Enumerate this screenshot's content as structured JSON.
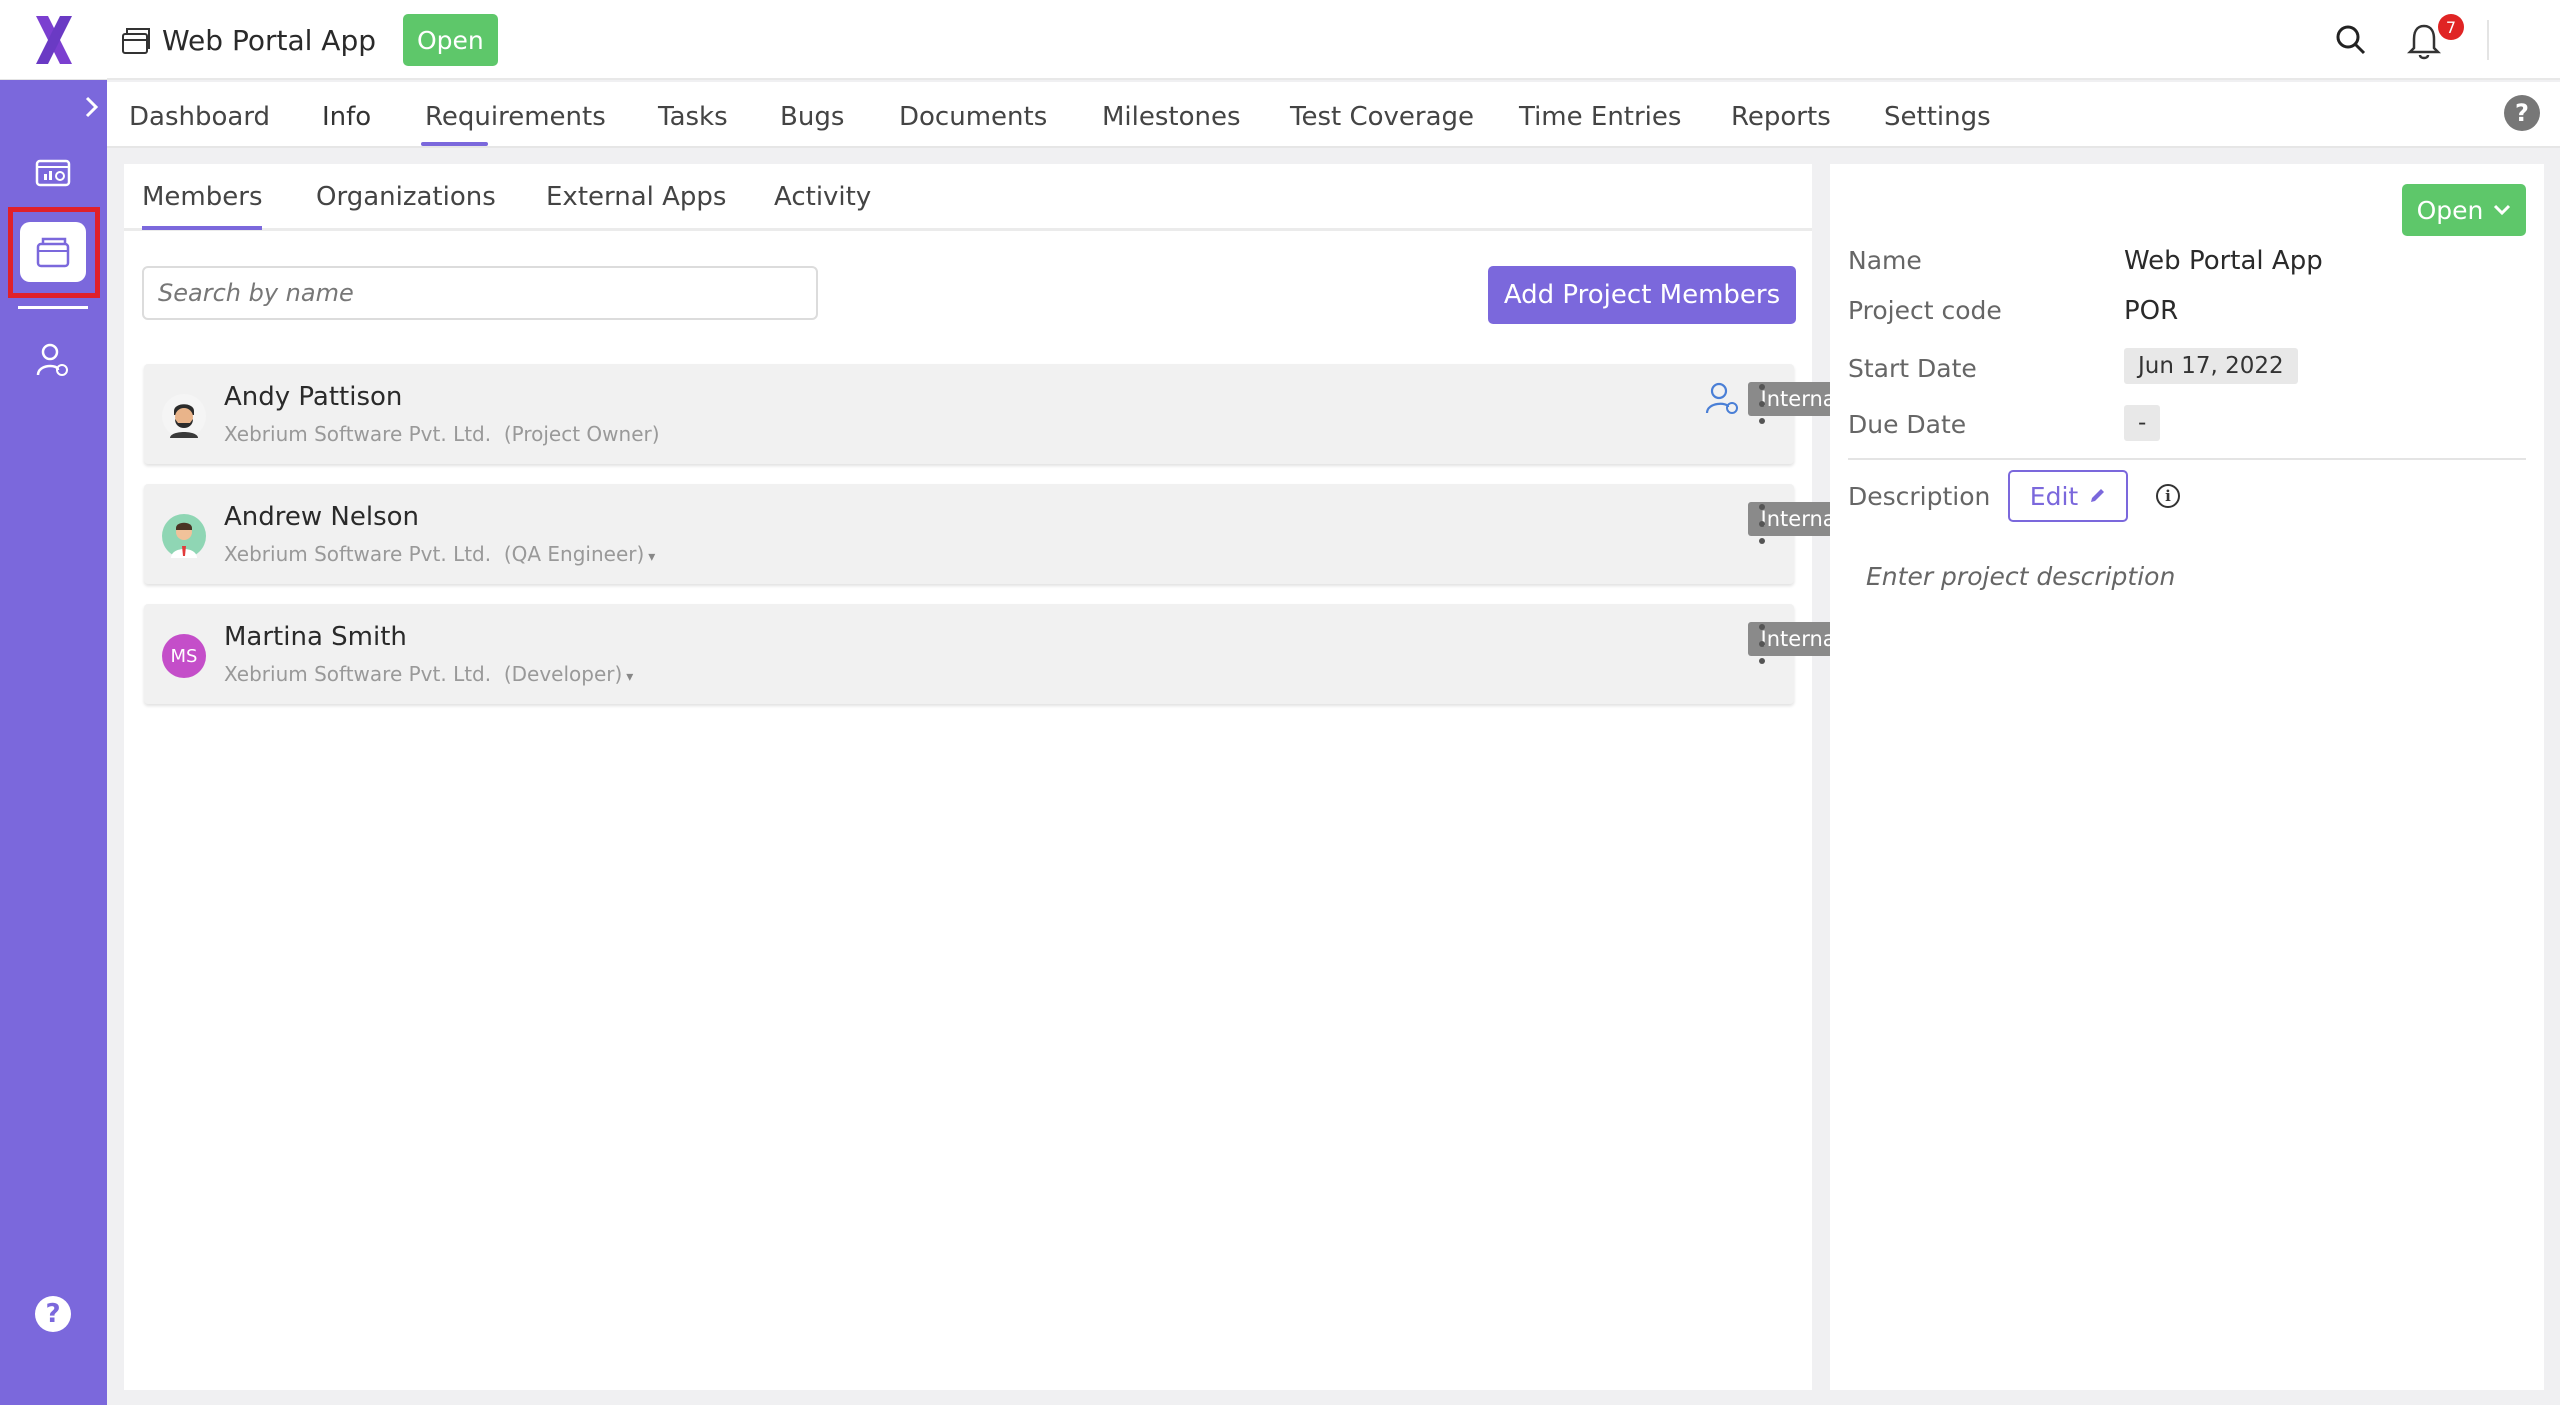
{
  "header": {
    "project_title": "Web Portal App",
    "status": "Open",
    "notification_count": "7"
  },
  "main_tabs": [
    {
      "label": "Dashboard"
    },
    {
      "label": "Info"
    },
    {
      "label": "Requirements"
    },
    {
      "label": "Tasks"
    },
    {
      "label": "Bugs"
    },
    {
      "label": "Documents"
    },
    {
      "label": "Milestones"
    },
    {
      "label": "Test Coverage"
    },
    {
      "label": "Time Entries"
    },
    {
      "label": "Reports"
    },
    {
      "label": "Settings"
    }
  ],
  "active_main_tab": "Info",
  "sub_tabs": [
    {
      "label": "Members"
    },
    {
      "label": "Organizations"
    },
    {
      "label": "External Apps"
    },
    {
      "label": "Activity"
    }
  ],
  "active_sub_tab": "Members",
  "members_panel": {
    "search_placeholder": "Search by name",
    "add_button": "Add Project Members",
    "members": [
      {
        "name": "Andy Pattison",
        "org": "Xebrium Software Pvt. Ltd.",
        "role": "(Project Owner)",
        "badge": "Internal",
        "avatar": "bearded-man-avatar"
      },
      {
        "name": "Andrew Nelson",
        "org": "Xebrium Software Pvt. Ltd.",
        "role": "(QA Engineer)",
        "badge": "Internal",
        "avatar": "man-tie-avatar"
      },
      {
        "name": "Martina Smith",
        "org": "Xebrium Software Pvt. Ltd.",
        "role": "(Developer)",
        "badge": "Internal",
        "initials": "MS"
      }
    ]
  },
  "project_info": {
    "status": "Open",
    "name_label": "Name",
    "name_value": "Web Portal App",
    "code_label": "Project code",
    "code_value": "POR",
    "start_label": "Start Date",
    "start_value": "Jun 17, 2022",
    "due_label": "Due Date",
    "due_value": "-",
    "description_label": "Description",
    "edit_label": "Edit",
    "description_placeholder": "Enter project description"
  },
  "colors": {
    "brand": "#7b68dc",
    "status_green": "#5ec76a",
    "highlight_red": "#e0202a",
    "badge_gray": "#8a8a8a"
  }
}
